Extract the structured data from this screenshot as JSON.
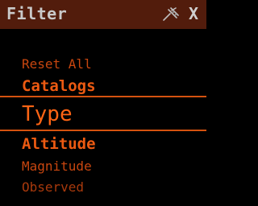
{
  "window": {
    "title": "Filter",
    "pin_icon": "pin-icon",
    "close_label": "X"
  },
  "menu": {
    "reset_all": "Reset All",
    "items": [
      {
        "label": "Catalogs"
      },
      {
        "label": "Type",
        "selected": true
      },
      {
        "label": "Altitude"
      },
      {
        "label": "Magnitude"
      },
      {
        "label": "Observed"
      }
    ]
  },
  "colors": {
    "titlebar_bg": "#521c0c",
    "accent": "#ff6414",
    "background": "#000000"
  }
}
